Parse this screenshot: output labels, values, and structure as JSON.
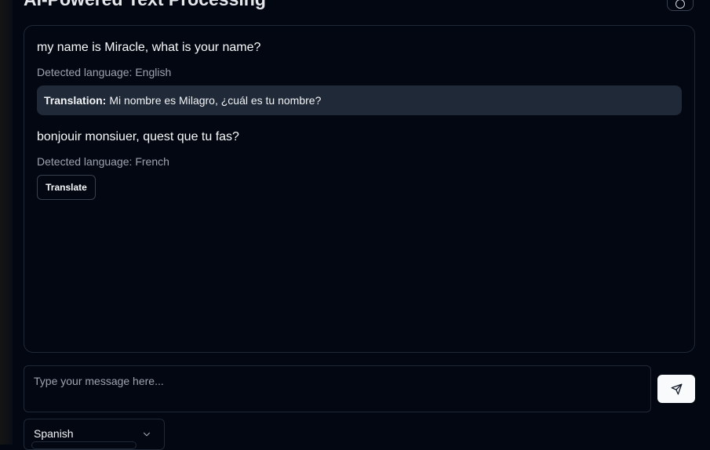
{
  "header": {
    "title": "AI-Powered Text Processing",
    "corner_button_icon": "refresh-icon"
  },
  "messages": [
    {
      "text": "my name is Miracle, what is your name?",
      "detected_language": "Detected language: English",
      "translation_label": "Translation:",
      "translation_text": "Mi nombre es Milagro, ¿cuál es tu nombre?"
    },
    {
      "text": "bonjouir monsiuer, quest que tu fas?",
      "detected_language": "Detected language: French",
      "translate_button_label": "Translate"
    }
  ],
  "composer": {
    "placeholder": "Type your message here...",
    "value": "",
    "send_icon": "send-icon"
  },
  "language_select": {
    "selected": "Spanish",
    "icon": "chevron-down-icon"
  },
  "colors": {
    "background": "#030712",
    "border": "#1f2937",
    "translation_bg": "#1f2937",
    "muted_text": "#9ca3af",
    "send_button_bg": "#f9fafb"
  }
}
